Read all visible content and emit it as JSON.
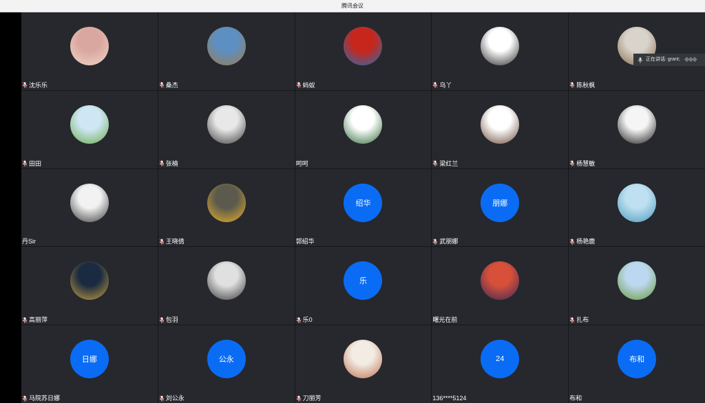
{
  "window": {
    "title": "腾讯会议"
  },
  "speaking": {
    "label": "正在讲话: grant;"
  },
  "participants": [
    {
      "name": "沈乐乐",
      "avatar_type": "photo",
      "avatar_colors": [
        "#d9a7a0",
        "#f1d5c8"
      ],
      "muted": true
    },
    {
      "name": "桑杰",
      "avatar_type": "photo",
      "avatar_colors": [
        "#5d8fc2",
        "#9c7c52"
      ],
      "muted": true
    },
    {
      "name": "蚂蚁",
      "avatar_type": "photo",
      "avatar_colors": [
        "#c7261b",
        "#2b6cb0"
      ],
      "muted": true
    },
    {
      "name": "乌丫",
      "avatar_type": "photo",
      "avatar_colors": [
        "#ffffff",
        "#2a2a2a"
      ],
      "muted": true
    },
    {
      "name": "陈秋枫",
      "avatar_type": "photo",
      "avatar_colors": [
        "#d8d4cc",
        "#8a6a4a"
      ],
      "muted": true
    },
    {
      "name": "田田",
      "avatar_type": "photo",
      "avatar_colors": [
        "#cfe7f5",
        "#6aab4a"
      ],
      "muted": true
    },
    {
      "name": "张楠",
      "avatar_type": "photo",
      "avatar_colors": [
        "#e8e8e8",
        "#3c3c3c"
      ],
      "muted": true
    },
    {
      "name": "呵呵",
      "avatar_type": "photo",
      "avatar_colors": [
        "#ffffff",
        "#2f6b3a"
      ],
      "muted": false
    },
    {
      "name": "梁红兰",
      "avatar_type": "photo",
      "avatar_colors": [
        "#ffffff",
        "#6a4a3a"
      ],
      "muted": true
    },
    {
      "name": "杨慧敏",
      "avatar_type": "photo",
      "avatar_colors": [
        "#f5f5f5",
        "#1a1a1a"
      ],
      "muted": true
    },
    {
      "name": "丹Sir",
      "avatar_type": "photo",
      "avatar_colors": [
        "#f2f2f2",
        "#3a3a3a"
      ],
      "muted": false
    },
    {
      "name": "王晓倩",
      "avatar_type": "photo",
      "avatar_colors": [
        "#5c5a4c",
        "#e8b02a"
      ],
      "muted": true
    },
    {
      "name": "郭绍华",
      "avatar_type": "text",
      "avatar_text": "绍华",
      "muted": false
    },
    {
      "name": "武朋娜",
      "avatar_type": "text",
      "avatar_text": "朋娜",
      "muted": true
    },
    {
      "name": "杨艳鹿",
      "avatar_type": "photo",
      "avatar_colors": [
        "#bfe0f0",
        "#4a9ac0"
      ],
      "muted": true
    },
    {
      "name": "高丽萍",
      "avatar_type": "photo",
      "avatar_colors": [
        "#1a2a40",
        "#c8a040"
      ],
      "muted": true
    },
    {
      "name": "包羽",
      "avatar_type": "photo",
      "avatar_colors": [
        "#e0e0e0",
        "#3a3a3a"
      ],
      "muted": true
    },
    {
      "name": "乐0",
      "avatar_type": "text",
      "avatar_text": "乐",
      "muted": true
    },
    {
      "name": "曙光在前",
      "avatar_type": "photo",
      "avatar_colors": [
        "#d8503a",
        "#3a2a5a"
      ],
      "muted": false
    },
    {
      "name": "扎布",
      "avatar_type": "photo",
      "avatar_colors": [
        "#bcd8f0",
        "#6a9a3a"
      ],
      "muted": true
    },
    {
      "name": "马院苏日娜",
      "avatar_type": "text",
      "avatar_text": "日娜",
      "muted": true
    },
    {
      "name": "刘公永",
      "avatar_type": "text",
      "avatar_text": "公永",
      "muted": true
    },
    {
      "name": "刀丽芳",
      "avatar_type": "photo",
      "avatar_colors": [
        "#f2ece4",
        "#c07050"
      ],
      "muted": true
    },
    {
      "name": "136****5124",
      "avatar_type": "text",
      "avatar_text": "24",
      "muted": false
    },
    {
      "name": "布和",
      "avatar_type": "text",
      "avatar_text": "布和",
      "muted": false
    }
  ]
}
